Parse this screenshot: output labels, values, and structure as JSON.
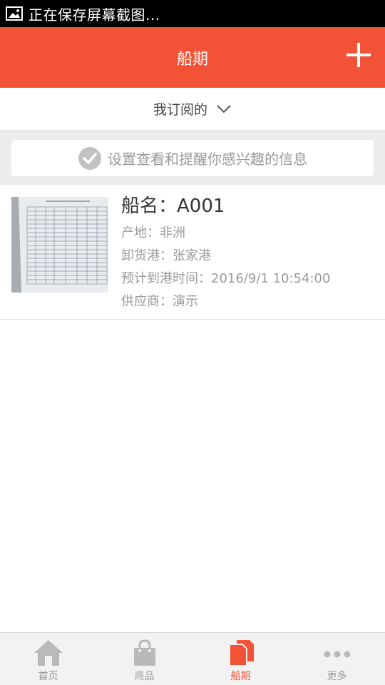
{
  "statusbar": {
    "text": "正在保存屏幕截图..."
  },
  "appbar": {
    "title": "船期",
    "add_icon": "plus-icon"
  },
  "filter": {
    "label": "我订阅的",
    "icon": "chevron-down-icon"
  },
  "tip": {
    "text": "设置查看和提醒你感兴趣的信息",
    "icon": "check-circle-icon"
  },
  "ship": {
    "name": "船名：A001",
    "origin": "产地：非洲",
    "port": "卸货港：张家港",
    "eta": "预计到港时间：2016/9/1 10:54:00",
    "supplier": "供应商：演示"
  },
  "tabs": [
    {
      "label": "首页",
      "icon": "home-icon"
    },
    {
      "label": "商品",
      "icon": "shopping-bag-icon"
    },
    {
      "label": "船期",
      "icon": "documents-icon",
      "active": true
    },
    {
      "label": "更多",
      "icon": "more-icon"
    }
  ],
  "colors": {
    "accent": "#f25236",
    "muted": "#9a9a9a",
    "tab_inactive": "#b9b9b9"
  }
}
